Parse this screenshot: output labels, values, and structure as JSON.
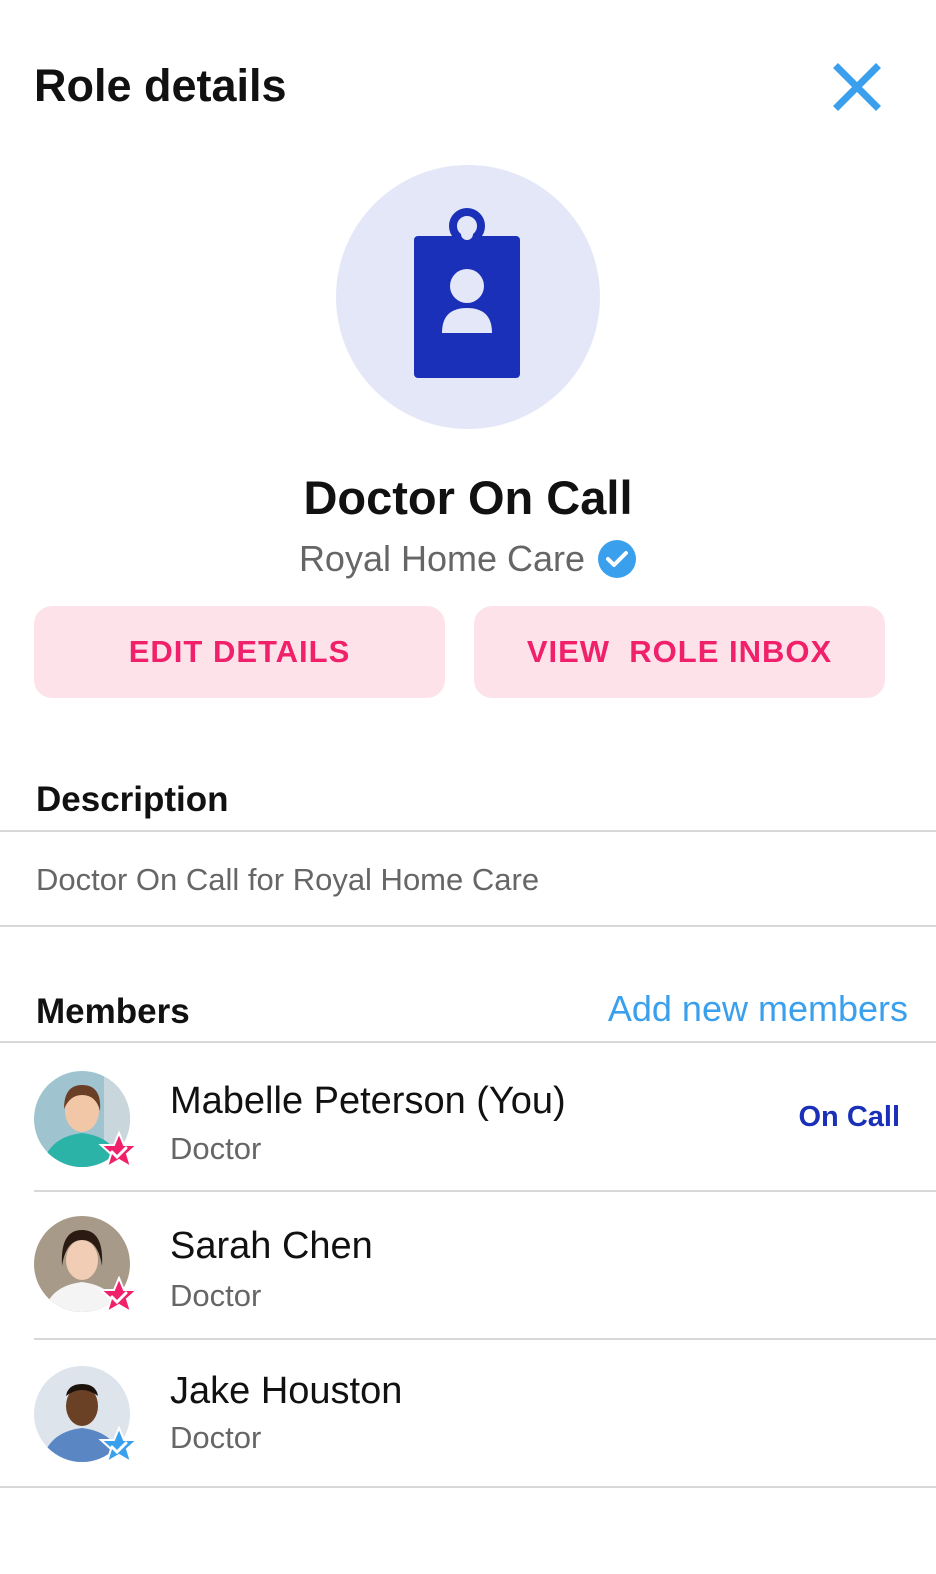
{
  "header": {
    "title": "Role details"
  },
  "icons": {
    "close": "close-icon",
    "badge": "id-badge-icon",
    "verified": "verified-check-icon",
    "member_star": "star-check-icon"
  },
  "role": {
    "name": "Doctor On Call",
    "organization": "Royal Home Care"
  },
  "actions": {
    "edit_label": "EDIT DETAILS",
    "inbox_label": "VIEW  ROLE INBOX"
  },
  "description": {
    "title": "Description",
    "text": "Doctor On Call for Royal Home Care"
  },
  "members": {
    "title": "Members",
    "add_label": "Add new members",
    "items": [
      {
        "name": "Mabelle Peterson (You)",
        "role": "Doctor",
        "status": "On Call",
        "badge_color": "#f0206a"
      },
      {
        "name": "Sarah Chen",
        "role": "Doctor",
        "status": "",
        "badge_color": "#f0206a"
      },
      {
        "name": "Jake Houston",
        "role": "Doctor",
        "status": "",
        "badge_color": "#3aa0ee"
      }
    ]
  },
  "colors": {
    "accent_blue": "#3aa0ee",
    "brand_navy": "#1a30b8",
    "accent_pink": "#f0206a",
    "button_bg": "#fde2ea"
  }
}
